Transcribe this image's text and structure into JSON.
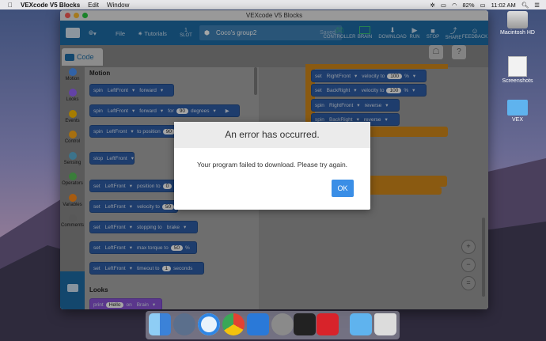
{
  "menubar": {
    "app_name": "VEXcode V5 Blocks",
    "menus": [
      "Edit",
      "Window"
    ],
    "battery": "82%",
    "clock": "11:02 AM"
  },
  "window": {
    "title": "VEXcode V5 Blocks",
    "toolbar": {
      "file_label": "File",
      "tutorials_label": "Tutorials",
      "slot_label": "SLOT",
      "slot_number": "1",
      "project_name": "Coco's group2",
      "saved_status": "Saved",
      "controller_label": "CONTROLLER",
      "brain_label": "BRAIN",
      "download_label": "DOWNLOAD",
      "run_label": "RUN",
      "stop_label": "STOP",
      "share_label": "SHARE",
      "feedback_label": "FEEDBACK"
    },
    "code_tab_label": "Code",
    "categories": [
      {
        "label": "Motion",
        "color": "#4c97ff"
      },
      {
        "label": "Looks",
        "color": "#9966ff"
      },
      {
        "label": "Events",
        "color": "#ffbf00"
      },
      {
        "label": "Control",
        "color": "#ffab19"
      },
      {
        "label": "Sensing",
        "color": "#5cb1d6"
      },
      {
        "label": "Operators",
        "color": "#59c059"
      },
      {
        "label": "Variables",
        "color": "#ff8c1a"
      },
      {
        "label": "Comments",
        "color": "#888888"
      }
    ],
    "palette": {
      "motion_header": "Motion",
      "looks_header": "Looks",
      "blocks": {
        "b1": {
          "w1": "spin",
          "w2": "LeftFront",
          "w3": "forward"
        },
        "b2": {
          "w1": "spin",
          "w2": "LeftFront",
          "w3": "forward",
          "w4": "for",
          "n1": "90",
          "w5": "degrees"
        },
        "b3": {
          "w1": "spin",
          "w2": "LeftFront",
          "w3": "to position",
          "n1": "90"
        },
        "b4": {
          "w1": "stop",
          "w2": "LeftFront"
        },
        "b5": {
          "w1": "set",
          "w2": "LeftFront",
          "w3": "position to",
          "n1": "0"
        },
        "b6": {
          "w1": "set",
          "w2": "LeftFront",
          "w3": "velocity to",
          "n1": "50"
        },
        "b7": {
          "w1": "set",
          "w2": "LeftFront",
          "w3": "stopping to",
          "w4": "brake"
        },
        "b8": {
          "w1": "set",
          "w2": "LeftFront",
          "w3": "max torque to",
          "n1": "50",
          "w4": "%"
        },
        "b9": {
          "w1": "set",
          "w2": "LeftFront",
          "w3": "timeout to",
          "n1": "1",
          "w4": "seconds"
        },
        "b10": {
          "w1": "print",
          "n1": "Hello",
          "w2": "on",
          "w3": "Brain"
        }
      }
    },
    "canvas_blocks": {
      "c1": {
        "w1": "set",
        "w2": "RightFront",
        "w3": "velocity to",
        "n1": "100",
        "w4": "%"
      },
      "c2": {
        "w1": "set",
        "w2": "BackRight",
        "w3": "velocity to",
        "n1": "100",
        "w4": "%"
      },
      "c3": {
        "w1": "spin",
        "w2": "RightFront",
        "w3": "reverse"
      },
      "c4": {
        "w1": "spin",
        "w2": "BackRight",
        "w3": "reverse"
      }
    },
    "zoom": {
      "in": "+",
      "out": "−",
      "reset": "="
    }
  },
  "dialog": {
    "title": "An error has occurred.",
    "message": "Your program failed to download. Please try again.",
    "ok_label": "OK"
  },
  "desktop_icons": {
    "hd": "Macintosh HD",
    "screenshots": "Screenshots",
    "vex": "VEX"
  },
  "dock": {
    "apps": [
      "finder-icon",
      "launchpad-icon",
      "safari-icon",
      "chrome-icon",
      "xcode-icon",
      "system-preferences-icon",
      "vexcode-v5-icon",
      "vexcode-v5-blocks-icon",
      "downloads-folder-icon",
      "trash-icon"
    ]
  }
}
